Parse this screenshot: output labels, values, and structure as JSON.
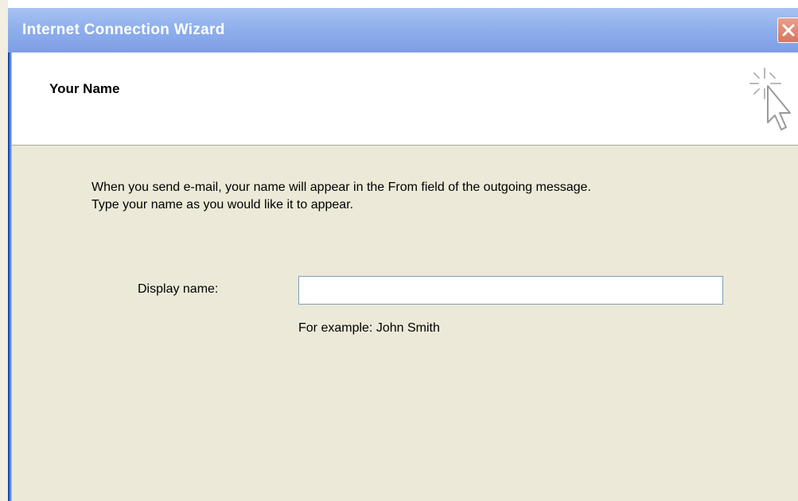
{
  "window": {
    "title": "Internet Connection Wizard",
    "close_icon": "close-icon"
  },
  "header": {
    "title": "Your Name",
    "icon": "wizard-cursor-sparkle-icon"
  },
  "body": {
    "description_line1": "When you send e-mail, your name will appear in the From field of the outgoing message.",
    "description_line2": "Type your name as you would like it to appear.",
    "display_name_label": "Display name:",
    "display_name_value": "",
    "example_text": "For example: John Smith"
  },
  "colors": {
    "titlebar": "#8fb0ec",
    "close_button": "#d6765e",
    "dialog_background": "#ece9d8",
    "header_background": "#ffffff"
  }
}
